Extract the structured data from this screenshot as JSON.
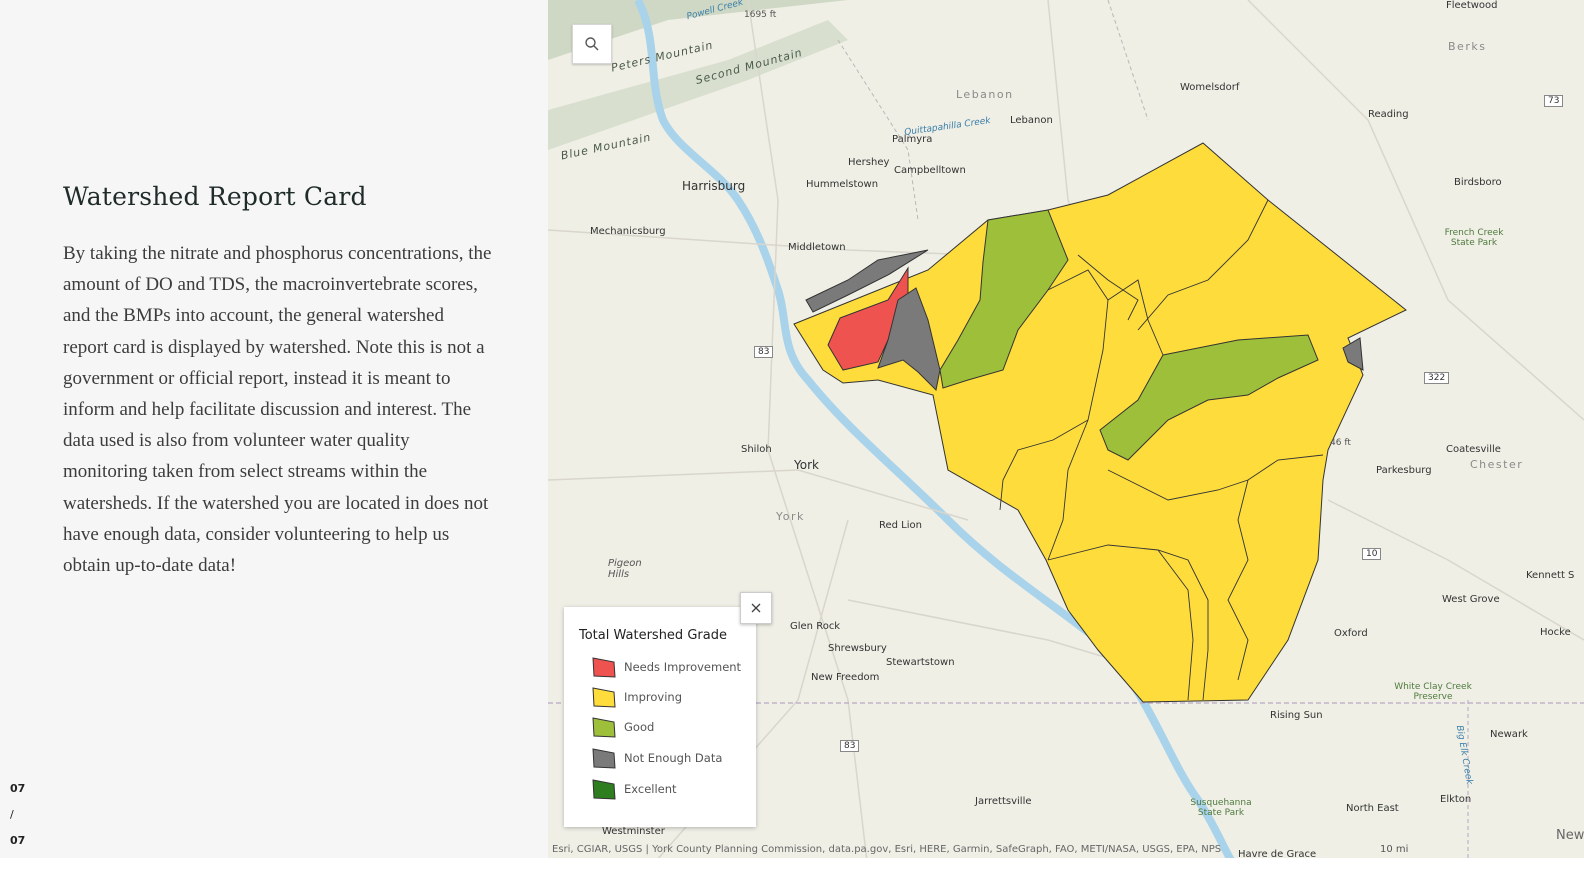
{
  "story": {
    "title": "Watershed Report Card",
    "body": "By taking the nitrate and phosphorus concentrations, the amount of DO and TDS, the macroinvertebrate scores, and the BMPs into account, the general watershed report card is displayed by watershed. Note this is not a government or official report, instead it is meant to inform and help facilitate discussion and interest. The data used is also from volunteer water quality monitoring taken from select streams within the watersheds. If the watershed you are located in does not have enough data, consider volunteering to help us obtain up-to-date data!",
    "page_current": "07",
    "page_sep": "/",
    "page_total": "07"
  },
  "map": {
    "search_icon": "search-icon",
    "labels": {
      "fleetwood": "Fleetwood",
      "berks": "Berks",
      "peters_mountain": "Peters Mountain",
      "second_mountain": "Second Mountain",
      "blue_mountain": "Blue Mountain",
      "powell_creek": "Powell Creek",
      "elev_1695": "1695 ft",
      "lebanon_county": "Lebanon",
      "lebanon": "Lebanon",
      "womelsdorf": "Womelsdorf",
      "reading": "Reading",
      "quittapahilla": "Quittapahilla Creek",
      "palmyra": "Palmyra",
      "hershey": "Hershey",
      "campbelltown": "Campbelltown",
      "harrisburg": "Harrisburg",
      "hummelstown": "Hummelstown",
      "birdsboro": "Birdsboro",
      "mechanicsburg": "Mechanicsburg",
      "middletown": "Middletown",
      "french_creek": "French Creek State Park",
      "shiloh": "Shiloh",
      "york": "York",
      "york_county": "York",
      "red_lion": "Red Lion",
      "pigeon_hills": "Pigeon Hills",
      "coatesville": "Coatesville",
      "chester": "Chester",
      "parkesburg": "Parkesburg",
      "kennett": "Kennett S",
      "west_grove": "West Grove",
      "oxford": "Oxford",
      "hocke": "Hocke",
      "glen_rock": "Glen Rock",
      "shrewsbury": "Shrewsbury",
      "stewartstown": "Stewartstown",
      "new_freedom": "New Freedom",
      "white_clay": "White Clay Creek Preserve",
      "newark": "Newark",
      "rising_sun": "Rising Sun",
      "jarrettsville": "Jarrettsville",
      "susquehanna_sp": "Susquehanna State Park",
      "north_east": "North East",
      "elkton": "Elkton",
      "westminster": "Westminster",
      "havre": "Havre de Grace",
      "big_elk": "Big Elk Creek",
      "new_partial": "New",
      "elev_46": "46 ft",
      "route_83": "83",
      "route_83b": "83",
      "route_322": "322",
      "route_10": "10",
      "route_73": "73"
    },
    "attribution": "Esri, CGIAR, USGS | York County Planning Commission, data.pa.gov, Esri, HERE, Garmin, SafeGraph, FAO, METI/NASA, USGS, EPA, NPS",
    "scale_label": "10 mi",
    "colors": {
      "needs_improvement": "#ef5350",
      "improving": "#fddc3c",
      "good": "#9ebf3a",
      "not_enough_data": "#7a7a7a",
      "excellent": "#2e7d1f"
    }
  },
  "legend": {
    "title": "Total Watershed Grade",
    "close_icon": "close-icon",
    "items": [
      {
        "label": "Needs Improvement",
        "color": "#ef5350"
      },
      {
        "label": "Improving",
        "color": "#fddc3c"
      },
      {
        "label": "Good",
        "color": "#9ebf3a"
      },
      {
        "label": "Not Enough Data",
        "color": "#7a7a7a"
      },
      {
        "label": "Excellent",
        "color": "#2e7d1f"
      }
    ]
  }
}
